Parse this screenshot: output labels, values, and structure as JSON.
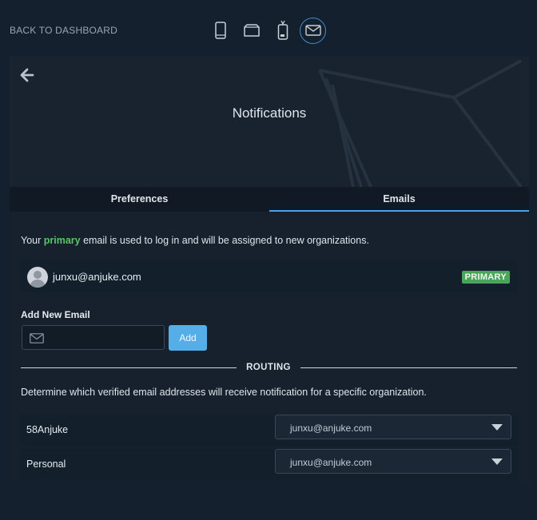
{
  "topbar": {
    "back_label": "BACK TO DASHBOARD",
    "devices": [
      {
        "icon": "mobile-phone-icon",
        "active": false
      },
      {
        "icon": "tablet-device-icon",
        "active": false
      },
      {
        "icon": "badge-device-icon",
        "active": false
      },
      {
        "icon": "envelope-icon",
        "active": true
      }
    ]
  },
  "hero": {
    "title": "Notifications",
    "back_icon": "arrow-left-icon"
  },
  "tabs": [
    {
      "label": "Preferences",
      "active": false
    },
    {
      "label": "Emails",
      "active": true
    }
  ],
  "emails": {
    "info_prefix": "Your ",
    "info_highlight": "primary",
    "info_suffix": " email is used to log in and will be assigned to new organizations.",
    "primary_email": "junxu@anjuke.com",
    "primary_badge": "PRIMARY",
    "add_label": "Add New Email",
    "add_placeholder": "",
    "add_button": "Add"
  },
  "routing": {
    "label": "ROUTING",
    "description": "Determine which verified email addresses will receive notification for a specific organization.",
    "rows": [
      {
        "organization": "58Anjuke",
        "email": "junxu@anjuke.com"
      },
      {
        "organization": "Personal",
        "email": "junxu@anjuke.com"
      }
    ]
  },
  "colors": {
    "background": "#14202d",
    "accent": "#4aa1e8",
    "primary_green": "#48a65a"
  }
}
